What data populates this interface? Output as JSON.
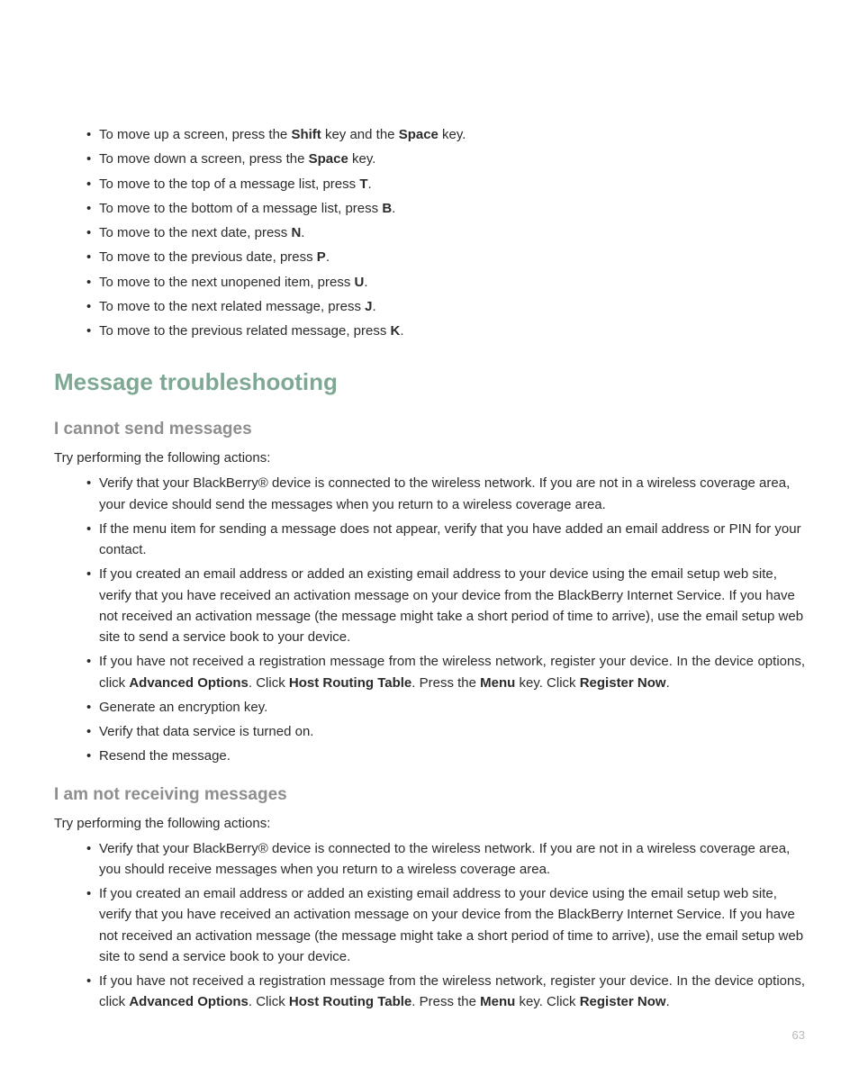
{
  "shortcuts": [
    {
      "pre": "To move up a screen, press the ",
      "b1": "Shift",
      "mid": " key and the ",
      "b2": "Space",
      "post": " key."
    },
    {
      "pre": "To move down a screen, press the ",
      "b1": "Space",
      "mid": "",
      "b2": "",
      "post": " key."
    },
    {
      "pre": "To move to the top of a message list, press ",
      "b1": "T",
      "mid": "",
      "b2": "",
      "post": "."
    },
    {
      "pre": "To move to the bottom of a message list, press ",
      "b1": "B",
      "mid": "",
      "b2": "",
      "post": "."
    },
    {
      "pre": "To move to the next date, press ",
      "b1": "N",
      "mid": "",
      "b2": "",
      "post": "."
    },
    {
      "pre": "To move to the previous date, press ",
      "b1": "P",
      "mid": "",
      "b2": "",
      "post": "."
    },
    {
      "pre": "To move to the next unopened item, press ",
      "b1": "U",
      "mid": "",
      "b2": "",
      "post": "."
    },
    {
      "pre": "To move to the next related message, press ",
      "b1": "J",
      "mid": "",
      "b2": "",
      "post": "."
    },
    {
      "pre": "To move to the previous related message, press ",
      "b1": "K",
      "mid": "",
      "b2": "",
      "post": "."
    }
  ],
  "section_title": "Message troubleshooting",
  "cannot_send": {
    "heading": "I cannot send messages",
    "intro": "Try performing the following actions:",
    "items": [
      {
        "runs": [
          {
            "t": "Verify that your BlackBerry® device is connected to the wireless network. If you are not in a wireless coverage area, your device should send the messages when you return to a wireless coverage area.",
            "b": false
          }
        ]
      },
      {
        "runs": [
          {
            "t": "If the menu item for sending a message does not appear, verify that you have added an email address or PIN for your contact.",
            "b": false
          }
        ]
      },
      {
        "runs": [
          {
            "t": "If you created an email address or added an existing email address to your device using the email setup web site, verify that you have received an activation message on your device from the BlackBerry Internet Service. If you have not received an activation message (the message might take a short period of time to arrive), use the email setup web site to send a service book to your device.",
            "b": false
          }
        ]
      },
      {
        "runs": [
          {
            "t": "If you have not received a registration message from the wireless network, register your device. In the device options, click ",
            "b": false
          },
          {
            "t": "Advanced Options",
            "b": true
          },
          {
            "t": ". Click ",
            "b": false
          },
          {
            "t": "Host Routing Table",
            "b": true
          },
          {
            "t": ". Press the ",
            "b": false
          },
          {
            "t": "Menu",
            "b": true
          },
          {
            "t": " key. Click ",
            "b": false
          },
          {
            "t": "Register Now",
            "b": true
          },
          {
            "t": ".",
            "b": false
          }
        ],
        "just": true
      },
      {
        "runs": [
          {
            "t": "Generate an encryption key.",
            "b": false
          }
        ]
      },
      {
        "runs": [
          {
            "t": "Verify that data service is turned on.",
            "b": false
          }
        ]
      },
      {
        "runs": [
          {
            "t": "Resend the message.",
            "b": false
          }
        ]
      }
    ]
  },
  "not_receiving": {
    "heading": "I am not receiving messages",
    "intro": "Try performing the following actions:",
    "items": [
      {
        "runs": [
          {
            "t": "Verify that your BlackBerry® device is connected to the wireless network. If you are not in a wireless coverage area, you should receive messages when you return to a wireless coverage area.",
            "b": false
          }
        ]
      },
      {
        "runs": [
          {
            "t": "If you created an email address or added an existing email address to your device using the email setup web site, verify that you have received an activation message on your device from the BlackBerry Internet Service. If you have not received an activation message (the message might take a short period of time to arrive), use the email setup web site to send a service book to your device.",
            "b": false
          }
        ]
      },
      {
        "runs": [
          {
            "t": "If you have not received a registration message from the wireless network, register your device. In the device options, click ",
            "b": false
          },
          {
            "t": "Advanced Options",
            "b": true
          },
          {
            "t": ". Click ",
            "b": false
          },
          {
            "t": "Host Routing Table",
            "b": true
          },
          {
            "t": ". Press the ",
            "b": false
          },
          {
            "t": "Menu",
            "b": true
          },
          {
            "t": " key. Click ",
            "b": false
          },
          {
            "t": "Register Now",
            "b": true
          },
          {
            "t": ".",
            "b": false
          }
        ],
        "just": true
      }
    ]
  },
  "page_number": "63"
}
